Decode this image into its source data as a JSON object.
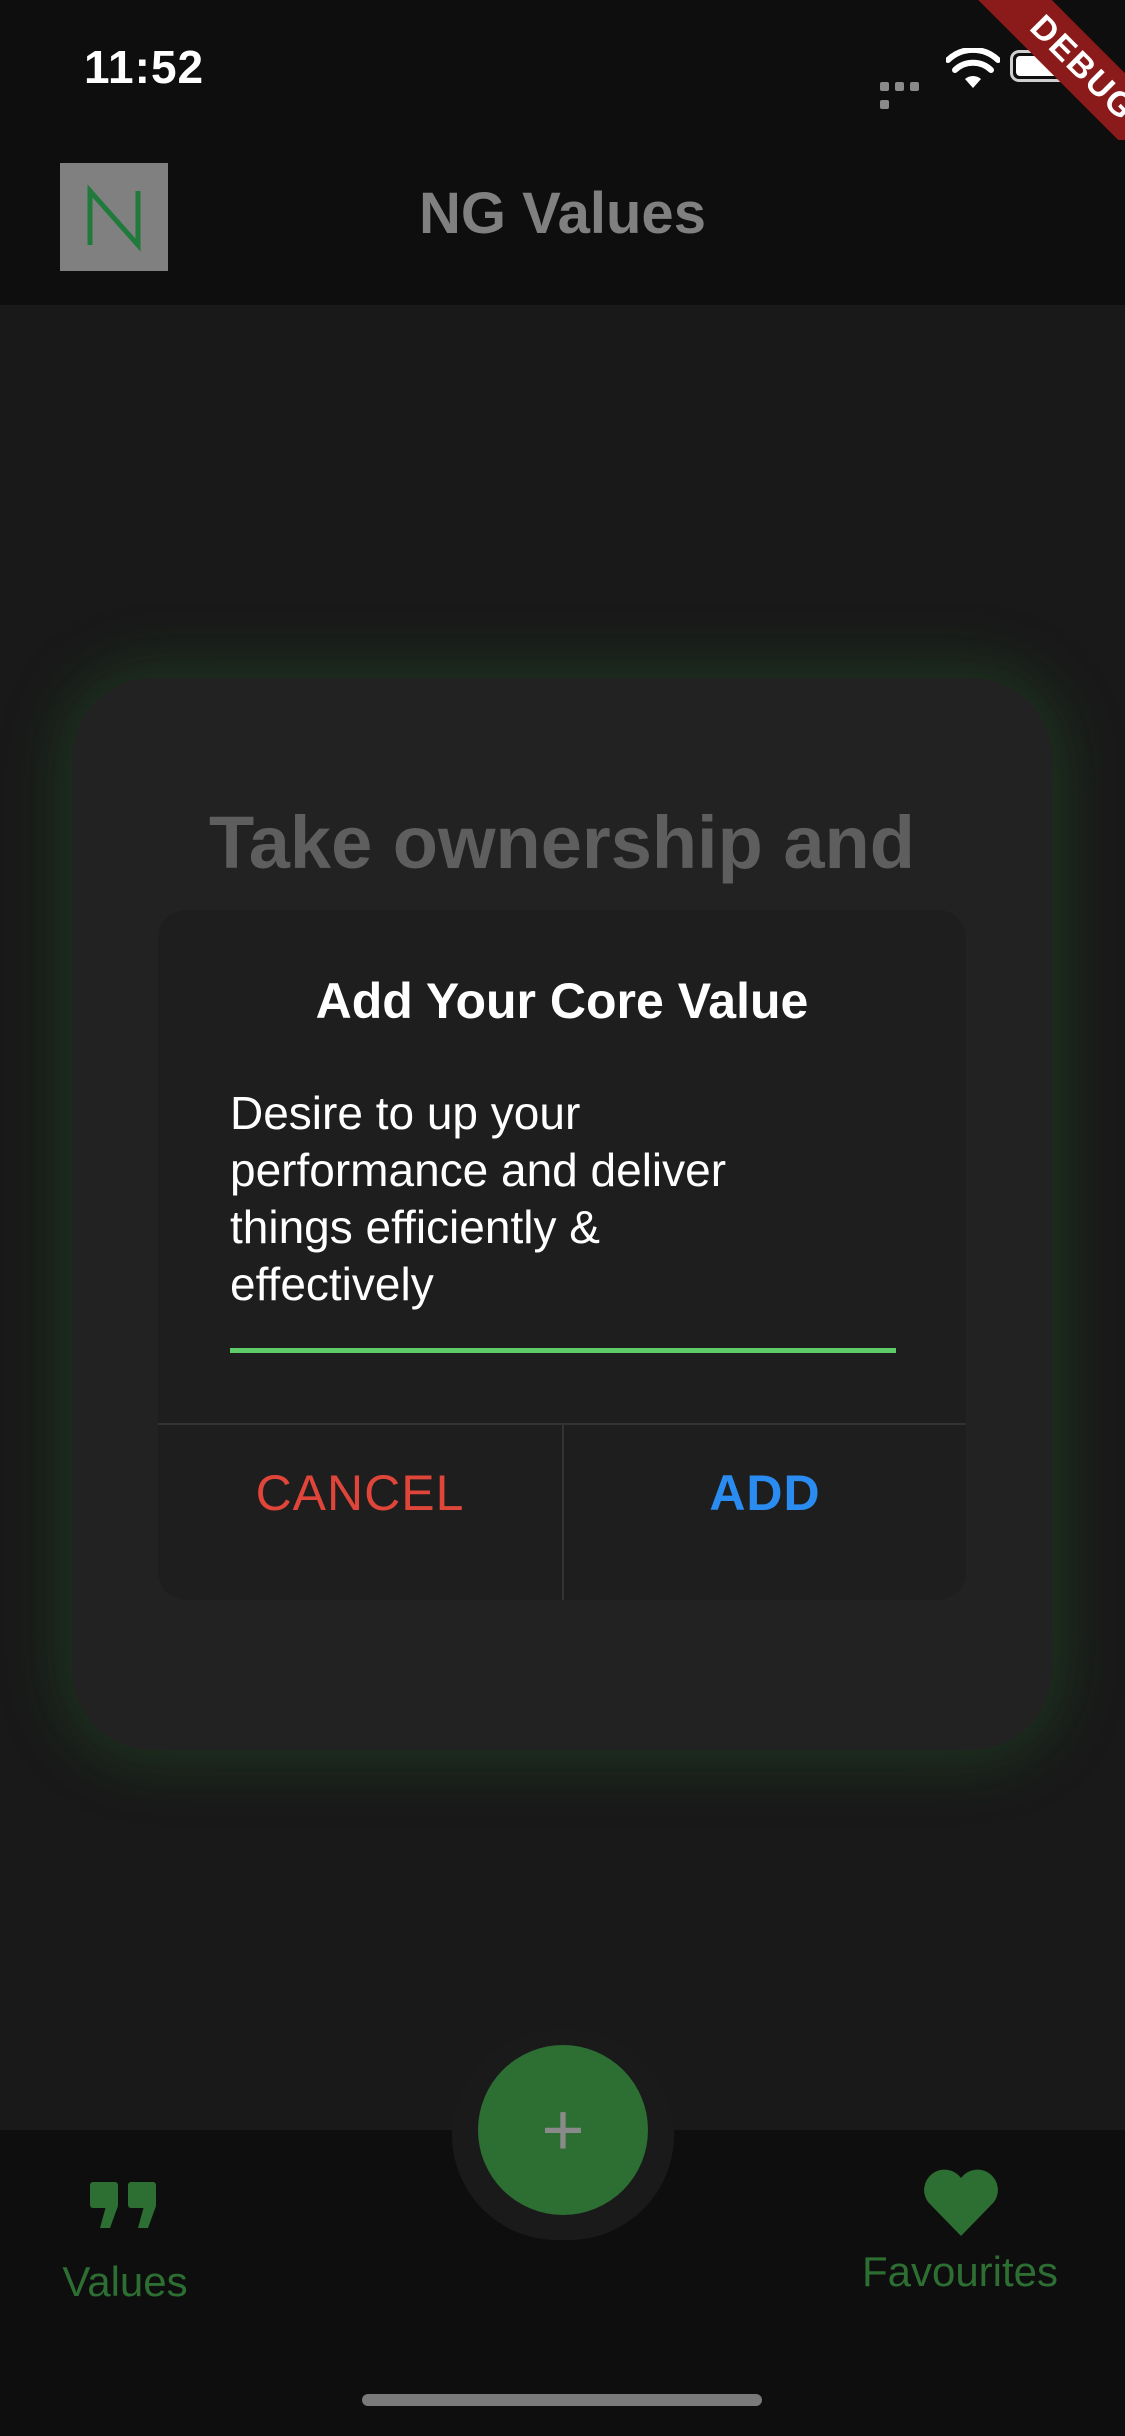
{
  "status_bar": {
    "time": "11:52",
    "debug_banner": "DEBUG"
  },
  "app_bar": {
    "title": "NG Values",
    "logo_icon": "ng-logo-icon"
  },
  "card": {
    "visible_text": "Take ownership and"
  },
  "dialog": {
    "title": "Add Your Core Value",
    "input_value": "Desire to up your\nperformance and deliver\nthings efficiently &\neffectively",
    "cancel_label": "CANCEL",
    "add_label": "ADD"
  },
  "bottom_nav": {
    "fab_label": "+",
    "items": [
      {
        "label": "Values",
        "icon": "quote-icon"
      },
      {
        "label": "Favourites",
        "icon": "heart-icon"
      }
    ]
  },
  "colors": {
    "accent_green": "#2d6e33",
    "input_underline": "#5fcc6a",
    "cancel_red": "#e0453a",
    "add_blue": "#2a8cf0"
  }
}
